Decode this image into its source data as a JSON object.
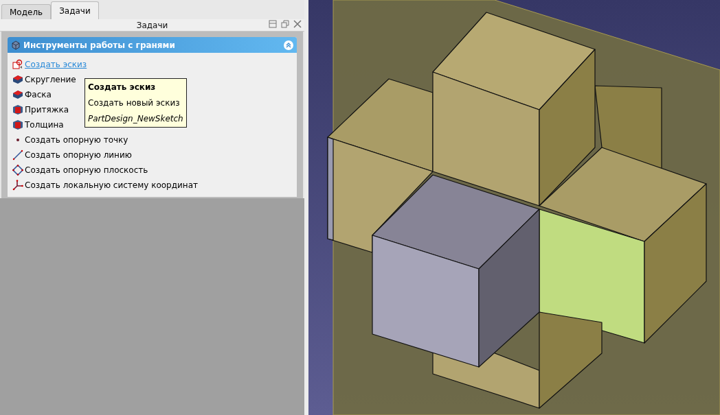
{
  "tabs": [
    {
      "label": "Модель",
      "selected": false
    },
    {
      "label": "Задачи",
      "selected": true
    }
  ],
  "dock": {
    "title": "Задачи"
  },
  "task_box": {
    "title": "Инструменты работы с гранями",
    "expanded": true,
    "items": [
      {
        "label": "Создать эскиз",
        "kind": "link"
      },
      {
        "label": "Скругление",
        "kind": "plain"
      },
      {
        "label": "Фаска",
        "kind": "plain"
      },
      {
        "label": "Притяжка",
        "kind": "plain"
      },
      {
        "label": "Толщина",
        "kind": "plain"
      },
      {
        "label": "Создать опорную точку",
        "kind": "plain"
      },
      {
        "label": "Создать опорную линию",
        "kind": "plain"
      },
      {
        "label": "Создать опорную плоскость",
        "kind": "plain"
      },
      {
        "label": "Создать локальную систему координат",
        "kind": "plain"
      }
    ]
  },
  "tooltip": {
    "title": "Создать эскиз",
    "description": "Создать новый эскиз",
    "command": "PartDesign_NewSketch"
  }
}
